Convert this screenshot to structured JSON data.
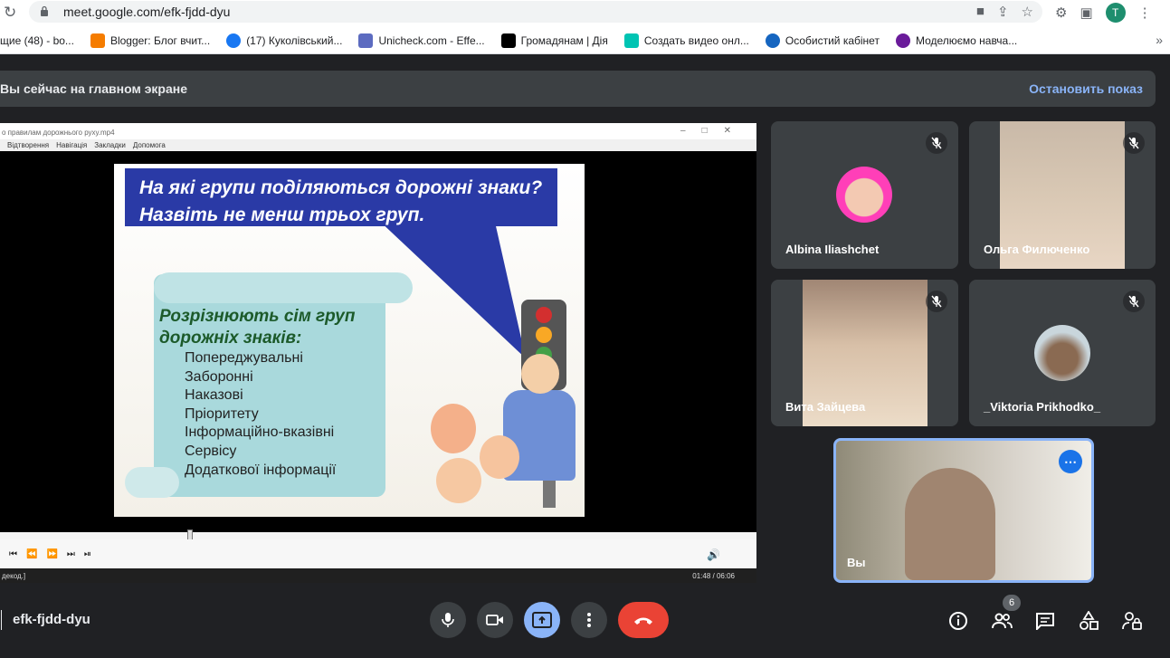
{
  "browser": {
    "url": "meet.google.com/efk-fjdd-dyu",
    "profile_initial": "T",
    "bookmarks": [
      {
        "label": "щие (48) - bo...",
        "color": "#ffffff"
      },
      {
        "label": "Blogger: Блог вчит...",
        "color": "#f57c00"
      },
      {
        "label": "(17) Куколівський...",
        "color": "#1877f2"
      },
      {
        "label": "Unicheck.com - Effe...",
        "color": "#5c6bc0"
      },
      {
        "label": "Громадянам | Дія",
        "color": "#000000"
      },
      {
        "label": "Создать видео онл...",
        "color": "#00c4b3"
      },
      {
        "label": "Особистий кабінет",
        "color": "#1565c0"
      },
      {
        "label": "Моделюємо навча...",
        "color": "#6a1b9a"
      }
    ],
    "more": "»"
  },
  "banner": {
    "text": "Вы сейчас на главном экране",
    "stop_label": "Остановить показ"
  },
  "player": {
    "title": "о правилам дорожнього руху.mp4",
    "menu": [
      "Відтворення",
      "Навігація",
      "Закладки",
      "Допомога"
    ],
    "status_left": "декод.]",
    "time": "01:48 / 06:06",
    "progress": 0.295
  },
  "slide": {
    "question": "На які групи поділяються дорожні знаки? Назвіть не менш трьох груп.",
    "groups_title": "Розрізнюють сім груп дорожніх знаків:",
    "groups": [
      "Попереджувальні",
      "Заборонні",
      "Наказові",
      "Пріоритету",
      "Інформаційно-вказівні",
      "Сервісу",
      "Додаткової інформації"
    ]
  },
  "participants": [
    {
      "name": "Albina Iliashchet"
    },
    {
      "name": "Ольга Филюченко"
    },
    {
      "name": "Вита Зайцева"
    },
    {
      "name": "_Viktoria Prikhodko_"
    }
  ],
  "self": {
    "name": "Вы"
  },
  "meeting": {
    "code": "efk-fjdd-dyu",
    "participant_count": "6"
  },
  "colors": {
    "background": "#202124",
    "tile": "#3c4043",
    "accent": "#8ab4f8",
    "hangup": "#ea4335",
    "present_active": "#8ab4f8"
  }
}
